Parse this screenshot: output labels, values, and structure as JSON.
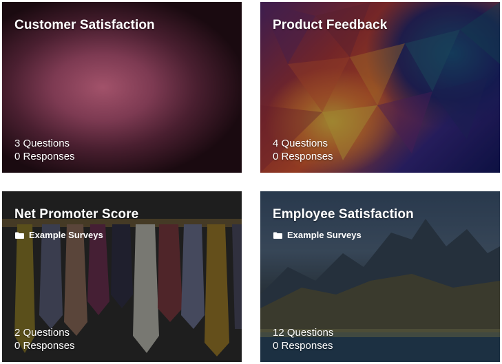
{
  "surveys": [
    {
      "title": "Customer Satisfaction",
      "folder": "",
      "questions": "3 Questions",
      "responses": "0 Responses"
    },
    {
      "title": "Product Feedback",
      "folder": "",
      "questions": "4 Questions",
      "responses": "0 Responses"
    },
    {
      "title": "Net Promoter Score",
      "folder": "Example Surveys",
      "questions": "2 Questions",
      "responses": "0 Responses"
    },
    {
      "title": "Employee Satisfaction",
      "folder": "Example Surveys",
      "questions": "12 Questions",
      "responses": "0 Responses"
    }
  ],
  "icons": {
    "folder": "folder-icon"
  }
}
